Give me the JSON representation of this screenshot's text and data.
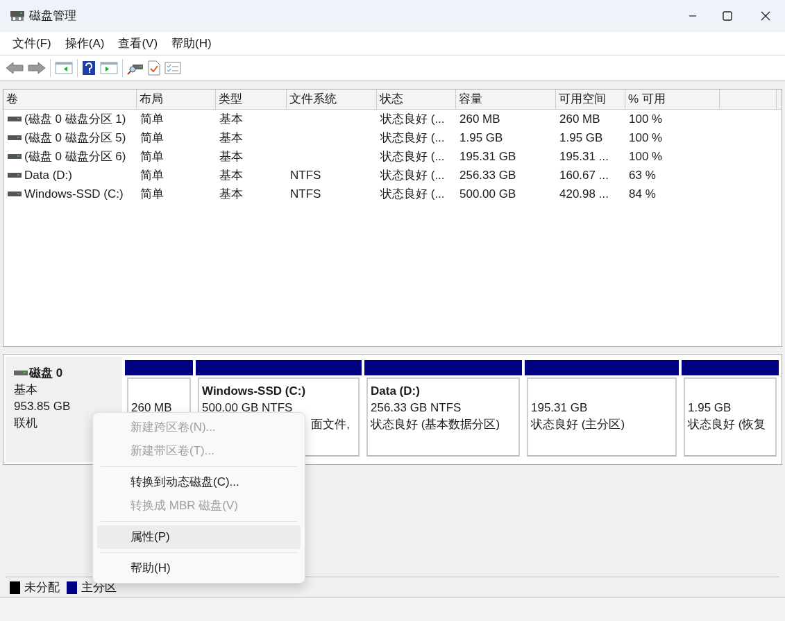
{
  "window": {
    "title": "磁盘管理"
  },
  "menu_bar": [
    "文件(F)",
    "操作(A)",
    "查看(V)",
    "帮助(H)"
  ],
  "volume_table": {
    "columns": [
      "卷",
      "布局",
      "类型",
      "文件系统",
      "状态",
      "容量",
      "可用空间",
      "% 可用"
    ],
    "rows": [
      {
        "selected": false,
        "cells": [
          "(磁盘 0 磁盘分区 1)",
          "简单",
          "基本",
          "",
          "状态良好 (...",
          "260 MB",
          "260 MB",
          "100 %"
        ]
      },
      {
        "selected": false,
        "cells": [
          "(磁盘 0 磁盘分区 5)",
          "简单",
          "基本",
          "",
          "状态良好 (...",
          "1.95 GB",
          "1.95 GB",
          "100 %"
        ]
      },
      {
        "selected": false,
        "cells": [
          "(磁盘 0 磁盘分区 6)",
          "简单",
          "基本",
          "",
          "状态良好 (...",
          "195.31 GB",
          "195.31 ...",
          "100 %"
        ]
      },
      {
        "selected": false,
        "cells": [
          "Data (D:)",
          "简单",
          "基本",
          "NTFS",
          "状态良好 (...",
          "256.33 GB",
          "160.67 ...",
          "63 %"
        ]
      },
      {
        "selected": false,
        "cells": [
          "Windows-SSD (C:)",
          "简单",
          "基本",
          "NTFS",
          "状态良好 (...",
          "500.00 GB",
          "420.98 ...",
          "84 %"
        ]
      }
    ]
  },
  "disk": {
    "name": "磁盘 0",
    "type": "基本",
    "size": "953.85 GB",
    "status": "联机",
    "partitions": [
      {
        "color": "#000080",
        "size": "260 MB"
      },
      {
        "color": "#000080",
        "label": "Windows-SSD  (C:)",
        "size": "500.00 GB NTFS",
        "status": "面文件,"
      },
      {
        "color": "#000080",
        "label": "Data  (D:)",
        "size": "256.33 GB NTFS",
        "status": "状态良好 (基本数据分区)"
      },
      {
        "color": "#000080",
        "size": "195.31 GB",
        "status": "状态良好 (主分区)"
      },
      {
        "color": "#000080",
        "size": "1.95 GB",
        "status": "状态良好 (恢复"
      }
    ]
  },
  "context_menu": [
    [
      {
        "label": "新建跨区卷(N)...",
        "disabled": true,
        "highlighted": false
      },
      {
        "label": "新建带区卷(T)...",
        "disabled": true,
        "highlighted": false
      }
    ],
    [
      {
        "label": "转换到动态磁盘(C)...",
        "disabled": false,
        "highlighted": false
      },
      {
        "label": "转换成 MBR 磁盘(V)",
        "disabled": true,
        "highlighted": false
      }
    ],
    [
      {
        "label": "属性(P)",
        "disabled": false,
        "highlighted": true
      }
    ],
    [
      {
        "label": "帮助(H)",
        "disabled": false,
        "highlighted": false
      }
    ]
  ],
  "legend": [
    {
      "label": "未分配",
      "color": "#000000"
    },
    {
      "label": "主分区",
      "color": "#000080"
    }
  ]
}
